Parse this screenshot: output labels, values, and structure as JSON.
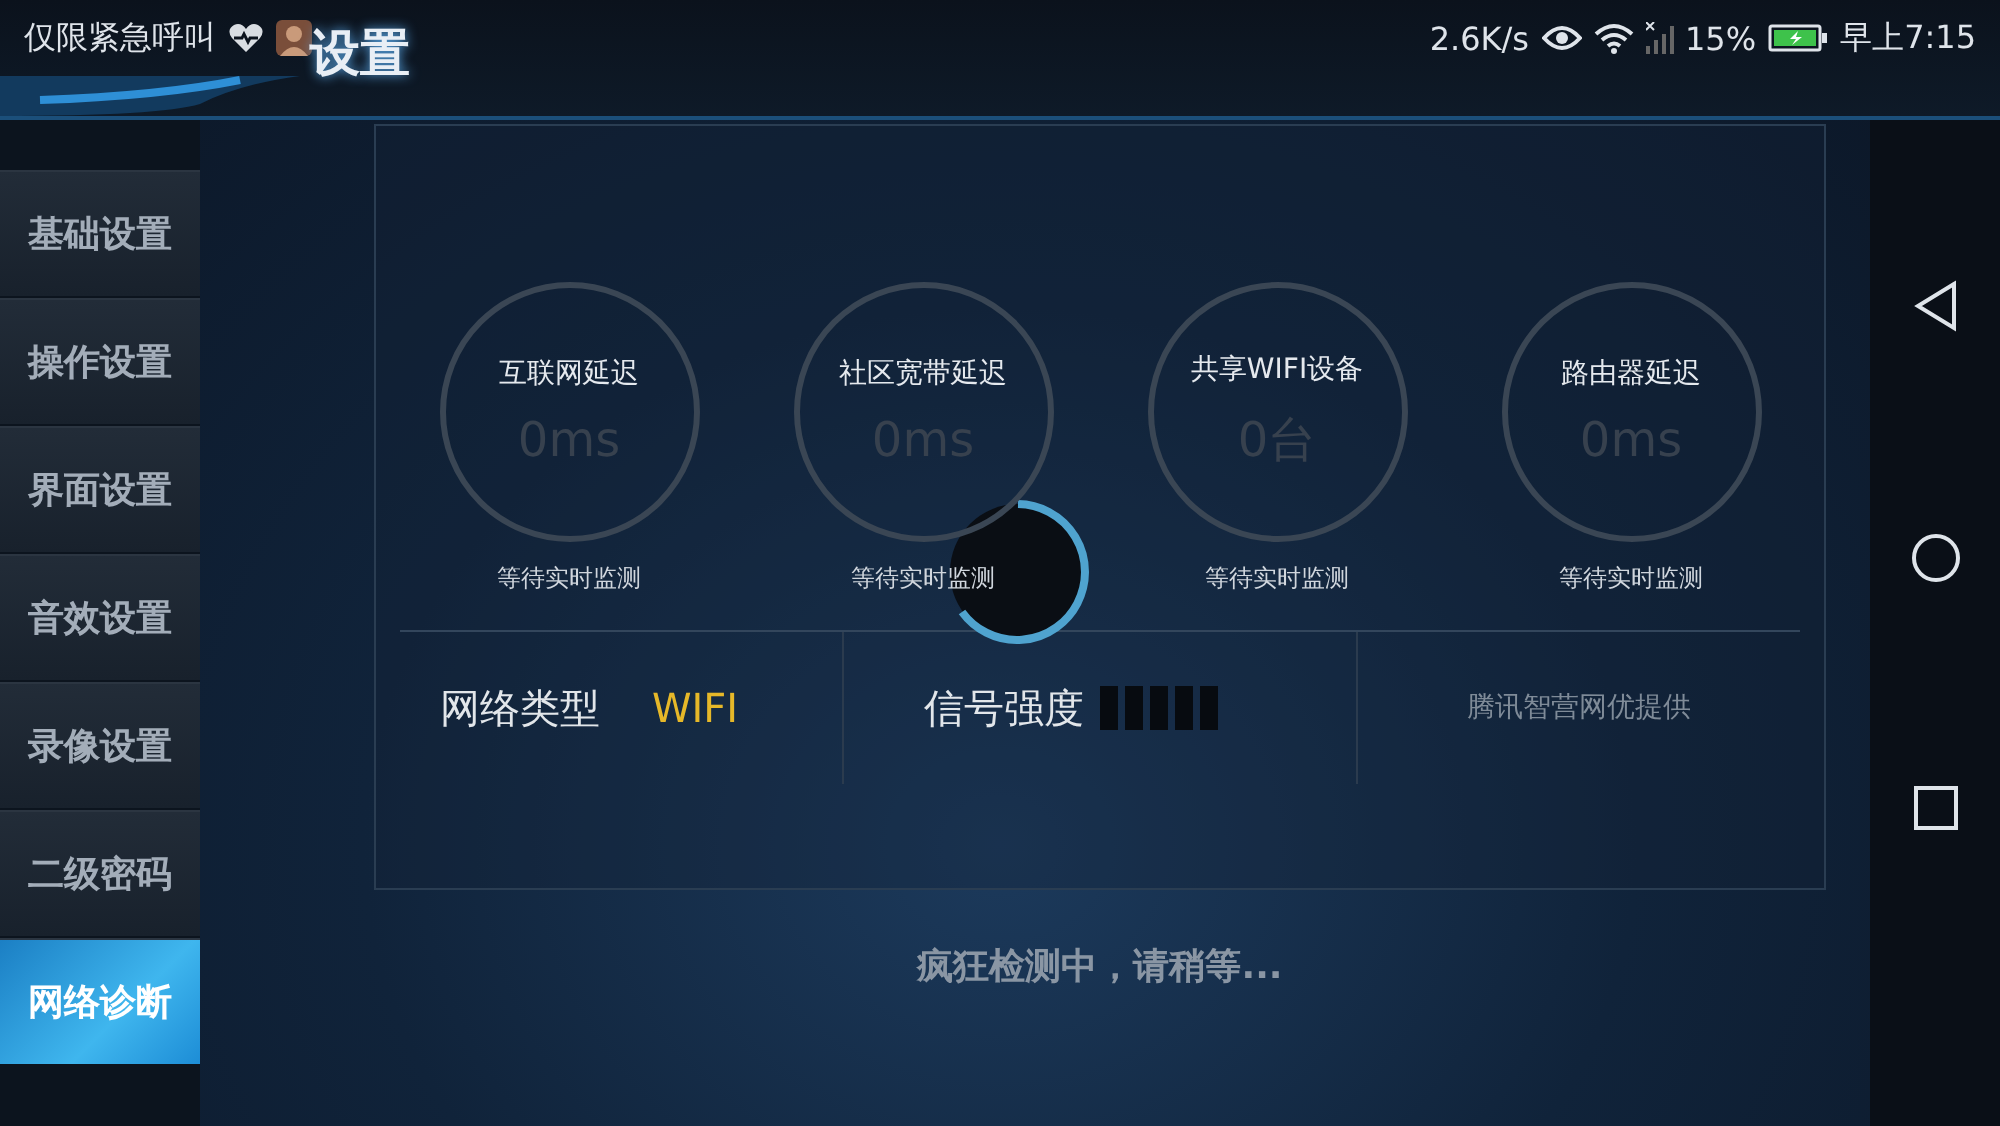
{
  "status_bar": {
    "notice": "仅限紧急呼叫",
    "speed": "2.6K/s",
    "battery": "15%",
    "time": "早上7:15"
  },
  "title": "设置",
  "sidebar": {
    "items": [
      {
        "label": "基础设置",
        "selected": false
      },
      {
        "label": "操作设置",
        "selected": false
      },
      {
        "label": "界面设置",
        "selected": false
      },
      {
        "label": "音效设置",
        "selected": false
      },
      {
        "label": "录像设置",
        "selected": false
      },
      {
        "label": "二级密码",
        "selected": false
      },
      {
        "label": "网络诊断",
        "selected": true
      }
    ]
  },
  "metrics": [
    {
      "label": "互联网延迟",
      "value": "0ms",
      "status": "等待实时监测"
    },
    {
      "label": "社区宽带延迟",
      "value": "0ms",
      "status": "等待实时监测"
    },
    {
      "label": "共享WIFI设备",
      "value": "0台",
      "status": "等待实时监测"
    },
    {
      "label": "路由器延迟",
      "value": "0ms",
      "status": "等待实时监测"
    }
  ],
  "network": {
    "type_label": "网络类型",
    "type_value": "WIFI",
    "signal_label": "信号强度",
    "provider": "腾讯智营网优提供"
  },
  "message": "疯狂检测中，请稍等..."
}
